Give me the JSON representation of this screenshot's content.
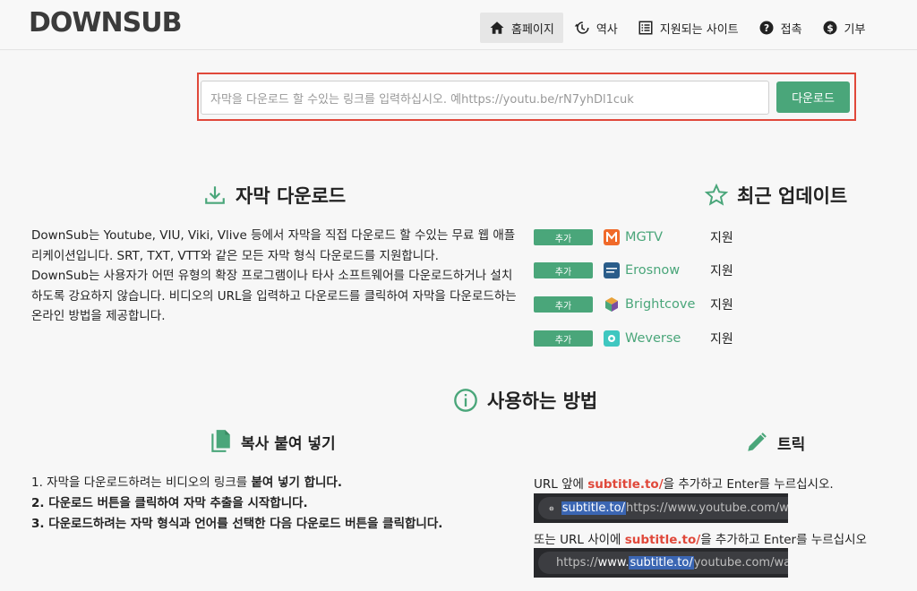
{
  "header": {
    "logo": "DOWNSUB",
    "nav": [
      {
        "label": "홈페이지",
        "icon": "home-icon"
      },
      {
        "label": "역사",
        "icon": "history-icon"
      },
      {
        "label": "지원되는 사이트",
        "icon": "list-icon"
      },
      {
        "label": "접촉",
        "icon": "help-icon"
      },
      {
        "label": "기부",
        "icon": "dollar-icon"
      }
    ]
  },
  "search": {
    "placeholder": "자막을 다운로드 할 수있는 링크를 입력하십시오. 예https://youtu.be/rN7yhDl1cuk",
    "button": "다운로드"
  },
  "download_section": {
    "title": "자막 다운로드",
    "description_parts": [
      "DownSub는 Youtube, VIU, Viki, Vlive 등에서 자막을 직접 다운로드 할 수있는 무료 웹 애플리케이션입니다. SRT, TXT, VTT와 같은 모든 자막 형식 다운로드를 지원합니다.",
      "DownSub는 사용자가 어떤 유형의 확장 프로그램이나 타사 소프트웨어를 다운로드하거나 설치하도록 강요하지 않습니다. 비디오의 URL을 입력하고 다운로드를 클릭하여 자막을 다운로드하는 온라인 방법을 제공합니다."
    ]
  },
  "updates_section": {
    "title": "최근 업데이트",
    "items": [
      {
        "badge": "추가",
        "site": "MGTV",
        "status": "지원",
        "color": "#f06a2a"
      },
      {
        "badge": "추가",
        "site": "Erosnow",
        "status": "지원",
        "color": "#2a5d8a"
      },
      {
        "badge": "추가",
        "site": "Brightcove",
        "status": "지원",
        "color": "#7a4fa0"
      },
      {
        "badge": "추가",
        "site": "Weverse",
        "status": "지원",
        "color": "#3fc7c0"
      }
    ]
  },
  "howto": {
    "title": "사용하는 방법",
    "copy_title": "복사 붙여 넣기",
    "steps": {
      "s1_a": "1. 자막을 다운로드하려는 비디오의 링크를 ",
      "s1_b": "붙여 넣기 합니다.",
      "s2": "2. 다운로드 버튼을 클릭하여 자막 추출을 시작합니다.",
      "s3_a": "3. 다운로드하려는 자막 형식과 언어를 선택한 다음 ",
      "s3_b": "다운로드 버튼을 클릭합니다."
    },
    "trick_title": "트릭",
    "trick1": {
      "a": "URL 앞에 ",
      "b": "subtitle.to/",
      "c": "을 추가하고 Enter를 누르십시오."
    },
    "url1": {
      "hl": "subtitle.to/",
      "rest": "https://www.youtube.com/watc"
    },
    "trick2": {
      "a": "또는 URL 사이에 ",
      "b": "subtitle.to/",
      "c": "을 추가하고 Enter를 누르십시오"
    },
    "url2": {
      "a": "https://",
      "b": "www.",
      "hl": "subtitle.to/",
      "c": "youtube.com/watch?v"
    }
  },
  "colors": {
    "accent": "#4aa67a",
    "highlight": "#e0483a"
  }
}
